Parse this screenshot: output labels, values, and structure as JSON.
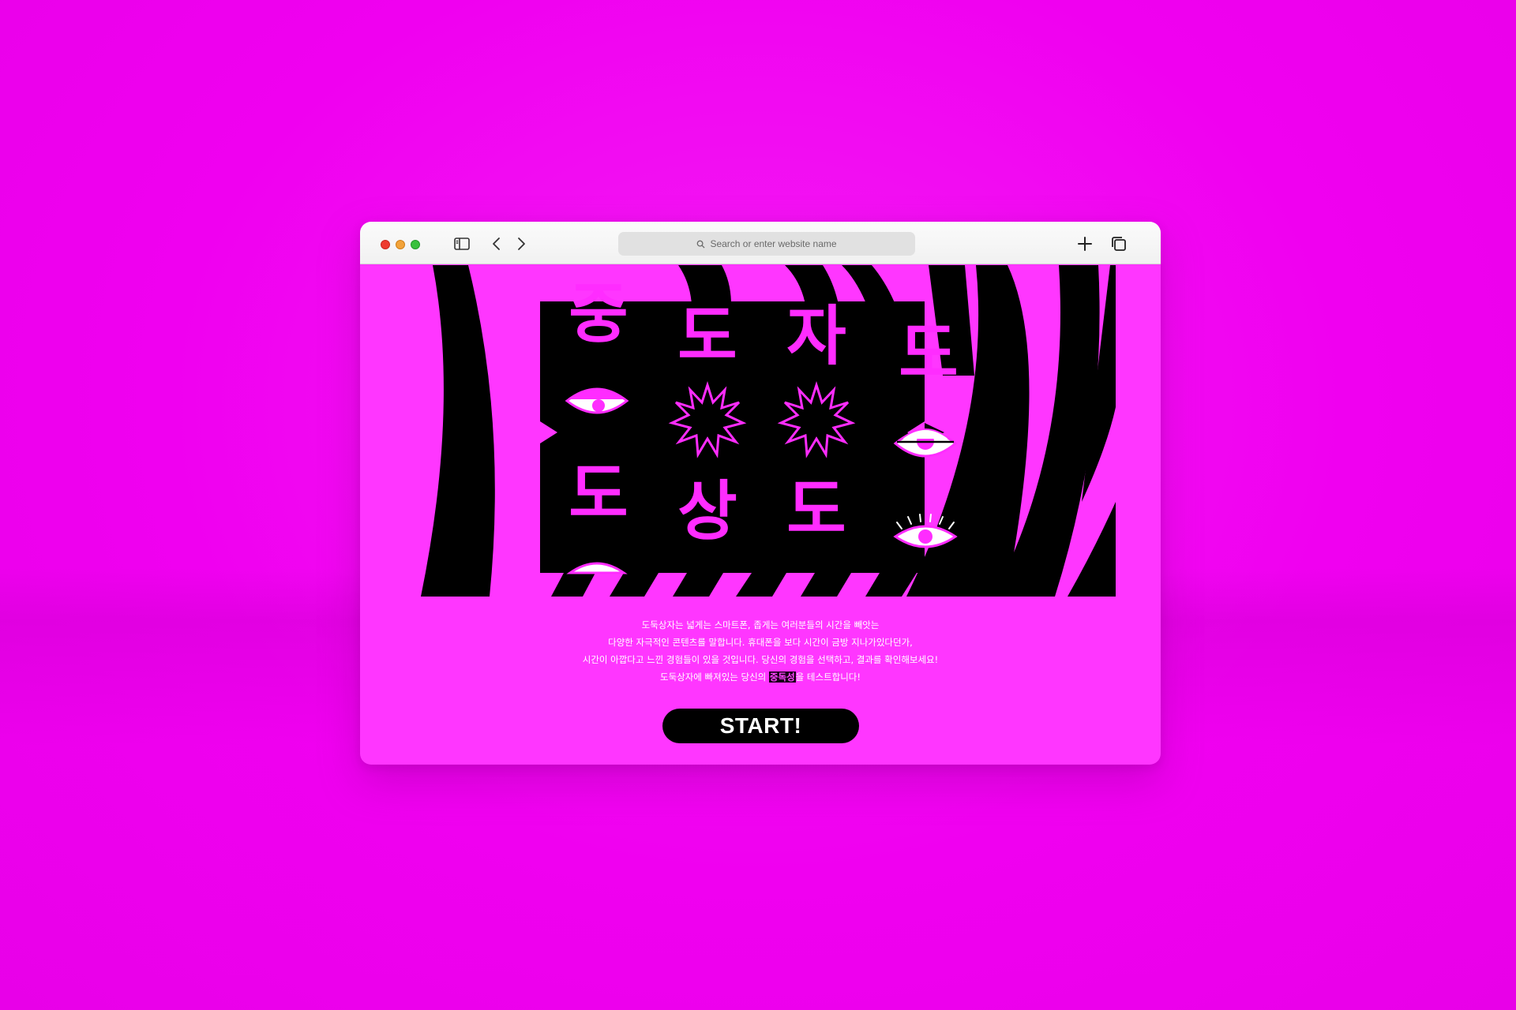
{
  "browser": {
    "address_placeholder": "Search or enter website name",
    "icons": [
      "sidebar-icon",
      "back-icon",
      "forward-icon",
      "search-icon",
      "new-tab-icon",
      "tabs-overview-icon"
    ]
  },
  "hero": {
    "glyphs": [
      "중",
      "도",
      "자",
      "도",
      "도",
      "상",
      "도"
    ],
    "colors": {
      "accent": "#ff2cff",
      "ink": "#000000",
      "page": "#ff36ff"
    }
  },
  "intro": {
    "line1": "도둑상자는 넓게는 스마트폰, 좁게는 여러분들의 시간을 빼앗는",
    "line2": "다양한 자극적인 콘텐츠를 말합니다. 휴대폰을 보다 시간이 금방 지나가있다던가,",
    "line3": "시간이 아깝다고 느낀 경험들이 있을 것입니다. 당신의 경험을 선택하고, 결과를 확인해보세요!",
    "line4_before": "도둑상자에 빠져있는 당신의 ",
    "line4_highlight": "중독성",
    "line4_after": "을 테스트합니다!"
  },
  "cta": {
    "start_label": "START!"
  }
}
